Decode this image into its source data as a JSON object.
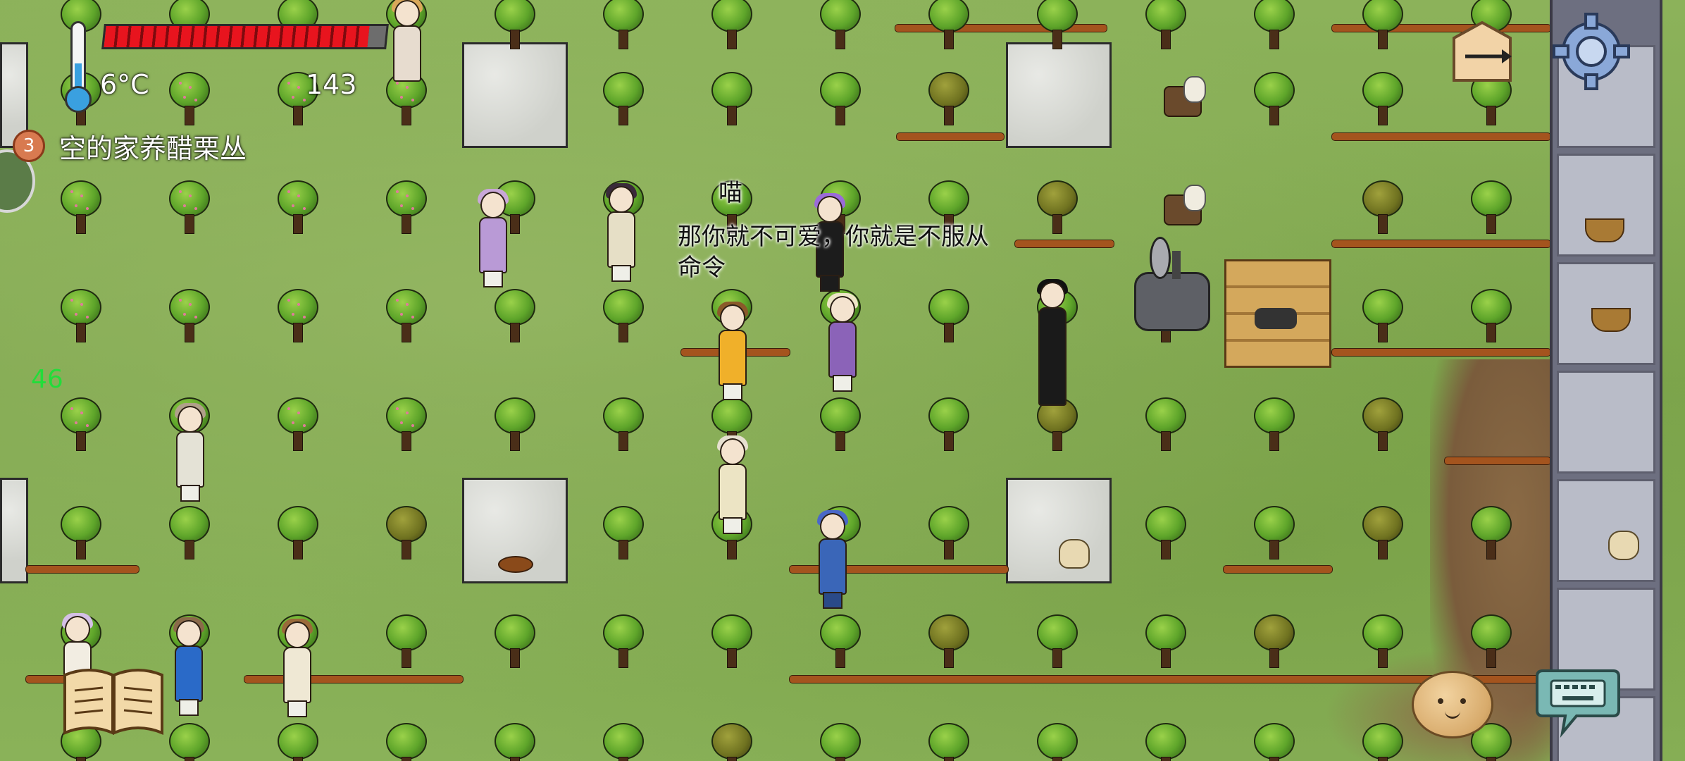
{
  "hud": {
    "temperature": "6°C",
    "counter": "143",
    "object_badge": "3",
    "object_label": "空的家养醋栗丛",
    "side_number": "46",
    "health_fraction": 0.94
  },
  "speech": {
    "cat": "喵",
    "line": "那你就不可爱，你就是不服从命令"
  },
  "colors": {
    "health": "#e8141e",
    "grass": "#8cb25a",
    "side_number": "#22dd3a",
    "stone": "#b9bcc8"
  },
  "controls": {
    "settings": "gear-icon",
    "compass": "compass-icon",
    "recipe_book": "book-icon",
    "emote": "emote-face-icon",
    "keyboard": "keyboard-icon"
  }
}
